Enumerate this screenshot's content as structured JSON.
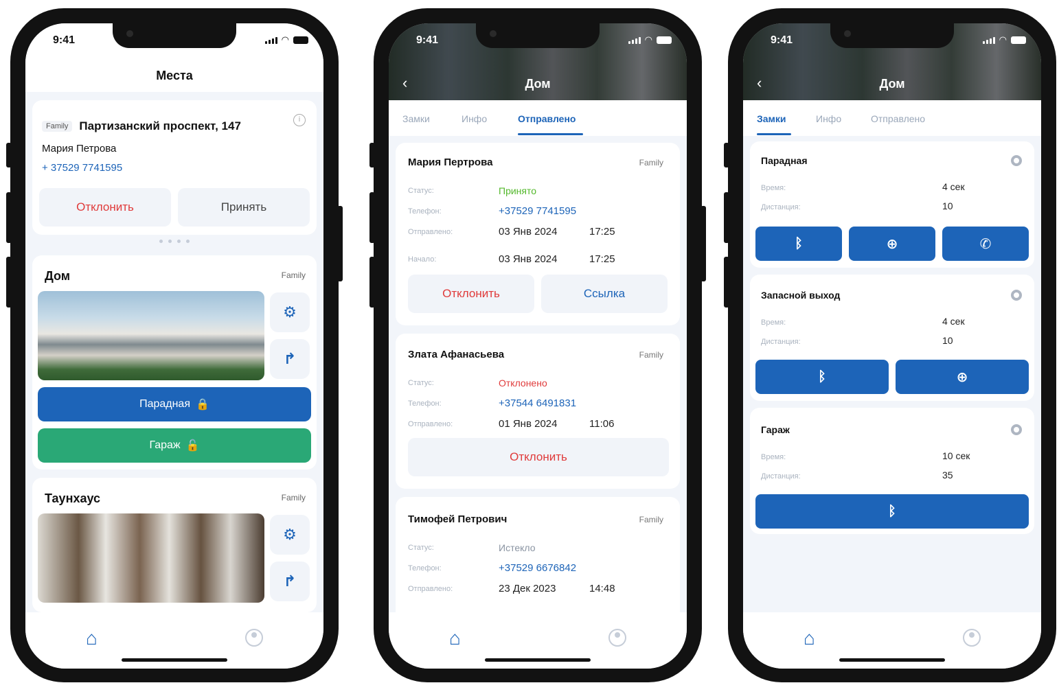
{
  "status": {
    "time": "9:41"
  },
  "screen1": {
    "title": "Места",
    "invite": {
      "tag": "Family",
      "address": "Партизанский проспект, 147",
      "name": "Мария Петрова",
      "phone": "+ 37529 7741595",
      "decline": "Отклонить",
      "accept": "Принять"
    },
    "places": [
      {
        "name": "Дом",
        "tag": "Family",
        "lock1": "Парадная",
        "lock2": "Гараж"
      },
      {
        "name": "Таунхаус",
        "tag": "Family"
      }
    ]
  },
  "screen2": {
    "title": "Дом",
    "tabs": [
      "Замки",
      "Инфо",
      "Отправлено"
    ],
    "labels": {
      "status": "Статус:",
      "phone": "Телефон:",
      "sent": "Отправлено:",
      "start": "Начало:"
    },
    "entries": [
      {
        "name": "Мария Пертрова",
        "tag": "Family",
        "status": "Принято",
        "phone": "+37529 7741595",
        "sent_date": "03 Янв 2024",
        "sent_time": "17:25",
        "start_date": "03 Янв 2024",
        "start_time": "17:25",
        "btn1": "Отклонить",
        "btn2": "Ссылка"
      },
      {
        "name": "Злата Афанасьева",
        "tag": "Family",
        "status": "Отклонено",
        "phone": "+37544 6491831",
        "sent_date": "01 Янв 2024",
        "sent_time": "11:06",
        "btn1": "Отклонить"
      },
      {
        "name": "Тимофей Петрович",
        "tag": "Family",
        "status": "Истекло",
        "phone": "+37529 6676842",
        "sent_date": "23 Дек 2023",
        "sent_time": "14:48"
      }
    ]
  },
  "screen3": {
    "title": "Дом",
    "tabs": [
      "Замки",
      "Инфо",
      "Отправлено"
    ],
    "labels": {
      "time": "Время:",
      "distance": "Дистанция:"
    },
    "locks": [
      {
        "name": "Парадная",
        "time": "4 сек",
        "distance": "10"
      },
      {
        "name": "Запасной выход",
        "time": "4 сек",
        "distance": "10"
      },
      {
        "name": "Гараж",
        "time": "10 сек",
        "distance": "35"
      }
    ]
  },
  "colors": {
    "primary": "#1d64b8",
    "green": "#2aa876",
    "danger": "#e03b3b",
    "accepted": "#53b82b"
  },
  "icons": [
    "home-icon",
    "profile-icon",
    "gear-icon",
    "share-icon",
    "bluetooth-icon",
    "globe-icon",
    "phone-icon",
    "lock-icon",
    "unlock-icon",
    "info-icon",
    "back-icon"
  ]
}
